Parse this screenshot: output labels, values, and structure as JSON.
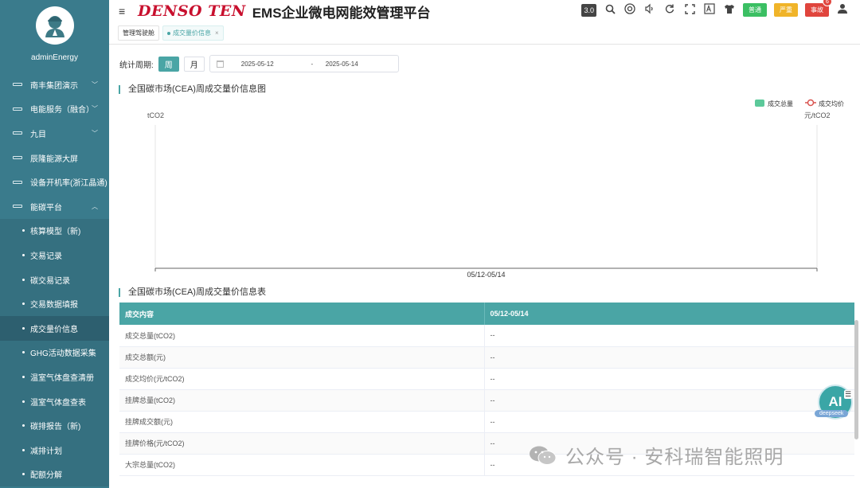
{
  "sidebar": {
    "username": "adminEnergy",
    "items": [
      {
        "label": "南丰集团演示",
        "caret": "﹀"
      },
      {
        "label": "电能服务（融合）",
        "caret": "﹀"
      },
      {
        "label": "九目",
        "caret": "﹀"
      },
      {
        "label": "辰隆能源大屏",
        "caret": ""
      },
      {
        "label": "设备开机率(浙江晶通)",
        "caret": ""
      },
      {
        "label": "能碳平台",
        "caret": "︿"
      }
    ],
    "sub_items": [
      {
        "label": "核算模型（新)",
        "active": false
      },
      {
        "label": "交易记录",
        "active": false
      },
      {
        "label": "碳交易记录",
        "active": false
      },
      {
        "label": "交易数据填报",
        "active": false
      },
      {
        "label": "成交量价信息",
        "active": true
      },
      {
        "label": "GHG活动数据采集",
        "active": false
      },
      {
        "label": "温室气体盘查清册",
        "active": false
      },
      {
        "label": "温室气体盘查表",
        "active": false
      },
      {
        "label": "碳排报告（新)",
        "active": false
      },
      {
        "label": "减排计划",
        "active": false
      },
      {
        "label": "配额分解",
        "active": false
      }
    ]
  },
  "header": {
    "menu_icon": "≡",
    "brand": "DENSO TEN",
    "title": "EMS企业微电网能效管理平台",
    "version": "3.0",
    "badges": {
      "normal": "普通",
      "severe": "严重",
      "accident": "事故",
      "accident_count": "6"
    }
  },
  "tabs": [
    {
      "label": "管理驾驶舱",
      "active": false
    },
    {
      "label": "成交量价信息",
      "active": true,
      "close": "×"
    }
  ],
  "filter": {
    "label": "统计周期:",
    "week": "周",
    "month": "月",
    "start_date": "2025-05-12",
    "separator": "-",
    "end_date": "2025-05-14"
  },
  "chart_section_title": "全国碳市场(CEA)周成交量价信息图",
  "chart_data": {
    "type": "bar",
    "categories": [
      "05/12-05/14"
    ],
    "series": [
      {
        "name": "成交总量",
        "values": [
          null
        ],
        "color": "#5cc99a"
      },
      {
        "name": "成交均价",
        "values": [
          null
        ],
        "color": "#d9534f"
      }
    ],
    "ylabel_left": "tCO2",
    "ylabel_right": "元/tCO2"
  },
  "table_section_title": "全国碳市场(CEA)周成交量价信息表",
  "table": {
    "headers": [
      "成交内容",
      "05/12-05/14"
    ],
    "rows": [
      [
        "成交总量(tCO2)",
        "--"
      ],
      [
        "成交总额(元)",
        "--"
      ],
      [
        "成交均价(元/tCO2)",
        "--"
      ],
      [
        "挂牌总量(tCO2)",
        "--"
      ],
      [
        "挂牌成交额(元)",
        "--"
      ],
      [
        "挂牌价格(元/tCO2)",
        "--"
      ],
      [
        "大宗总量(tCO2)",
        "--"
      ]
    ]
  },
  "ai_widget": {
    "label": "AI",
    "sub": "deepseek"
  },
  "watermark": "公众号 · 安科瑞智能照明"
}
